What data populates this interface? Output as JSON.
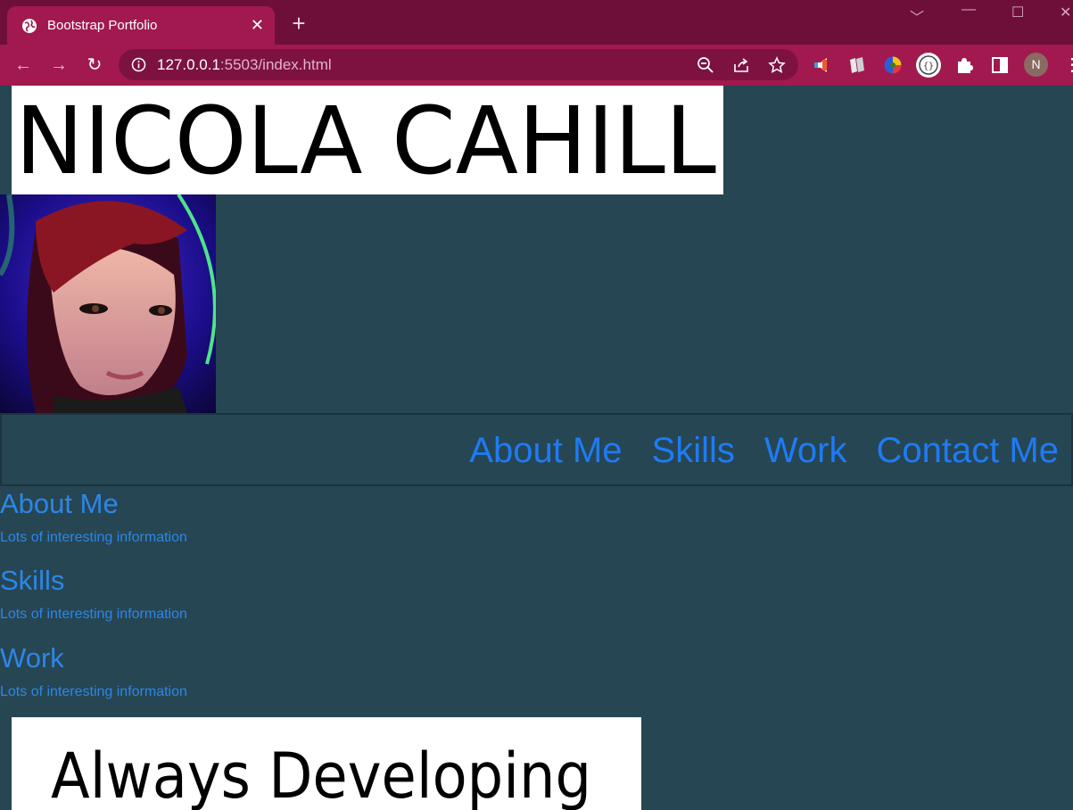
{
  "browser": {
    "tab": {
      "title": "Bootstrap Portfolio",
      "close_icon": "close-icon",
      "favicon": "globe-icon"
    },
    "new_tab_icon": "plus-icon",
    "address_bar": {
      "host": "127.0.0.1",
      "path": ":5503/index.html",
      "info_icon": "info-icon"
    },
    "profile_initial": "N",
    "colors": {
      "tabstrip": "#6e0f3a",
      "toolbar": "#a1194f",
      "omnibox": "#7d1241"
    }
  },
  "page": {
    "name_banner": "NICOLA CAHILL",
    "nav": {
      "links": [
        {
          "label": "About Me"
        },
        {
          "label": "Skills"
        },
        {
          "label": "Work"
        },
        {
          "label": "Contact Me"
        }
      ]
    },
    "sections": [
      {
        "title": "About Me",
        "text": "Lots of interesting information"
      },
      {
        "title": "Skills",
        "text": "Lots of interesting information"
      },
      {
        "title": "Work",
        "text": "Lots of interesting information"
      }
    ],
    "tagline_banner": "Always Developing",
    "colors": {
      "background": "#264653",
      "link": "#1e7bf5",
      "section_text": "#2d86e8"
    }
  }
}
